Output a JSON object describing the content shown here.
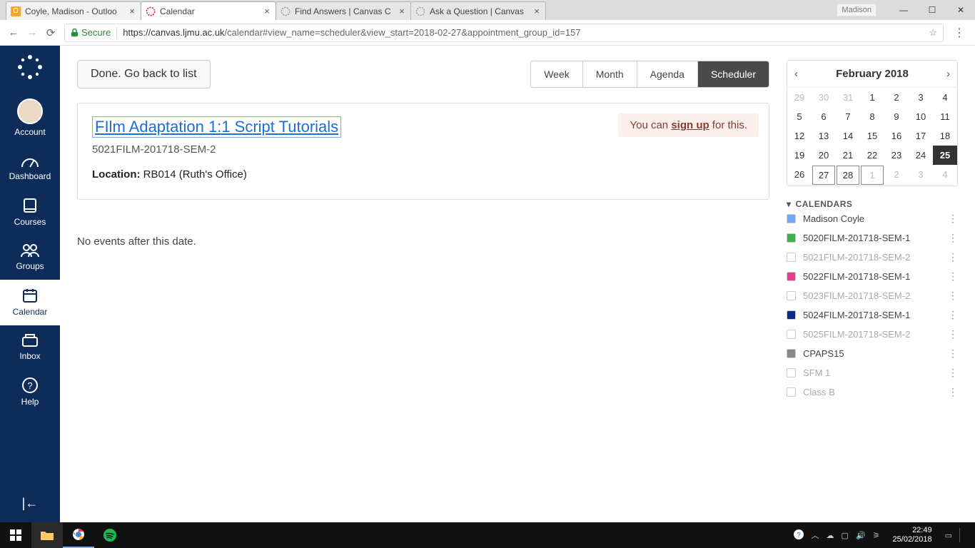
{
  "browser": {
    "tabs": [
      {
        "title": "Coyle, Madison - Outloo"
      },
      {
        "title": "Calendar"
      },
      {
        "title": "Find Answers | Canvas C"
      },
      {
        "title": "Ask a Question | Canvas"
      }
    ],
    "user_label": "Madison",
    "secure_label": "Secure",
    "url_host": "https://canvas.ljmu.ac.uk",
    "url_path": "/calendar#view_name=scheduler&view_start=2018-02-27&appointment_group_id=157"
  },
  "sidebar": {
    "items": [
      {
        "label": "Account"
      },
      {
        "label": "Dashboard"
      },
      {
        "label": "Courses"
      },
      {
        "label": "Groups"
      },
      {
        "label": "Calendar"
      },
      {
        "label": "Inbox"
      },
      {
        "label": "Help"
      }
    ]
  },
  "scheduler": {
    "done_label": "Done. Go back to list",
    "view_tabs": {
      "week": "Week",
      "month": "Month",
      "agenda": "Agenda",
      "scheduler": "Scheduler"
    },
    "event": {
      "title": "FIlm Adaptation 1:1 Script Tutorials",
      "subtitle": "5021FILM-201718-SEM-2",
      "location_label": "Location:",
      "location_value": "RB014 (Ruth's Office)",
      "signup_prefix": "You can ",
      "signup_link": "sign up",
      "signup_suffix": " for this."
    },
    "no_events": "No events after this date."
  },
  "minical": {
    "title": "February 2018",
    "cells": [
      {
        "d": "29",
        "muted": true
      },
      {
        "d": "30",
        "muted": true
      },
      {
        "d": "31",
        "muted": true
      },
      {
        "d": "1"
      },
      {
        "d": "2"
      },
      {
        "d": "3"
      },
      {
        "d": "4"
      },
      {
        "d": "5"
      },
      {
        "d": "6"
      },
      {
        "d": "7"
      },
      {
        "d": "8"
      },
      {
        "d": "9"
      },
      {
        "d": "10"
      },
      {
        "d": "11"
      },
      {
        "d": "12"
      },
      {
        "d": "13"
      },
      {
        "d": "14"
      },
      {
        "d": "15"
      },
      {
        "d": "16"
      },
      {
        "d": "17"
      },
      {
        "d": "18"
      },
      {
        "d": "19"
      },
      {
        "d": "20"
      },
      {
        "d": "21"
      },
      {
        "d": "22"
      },
      {
        "d": "23"
      },
      {
        "d": "24"
      },
      {
        "d": "25",
        "today": true
      },
      {
        "d": "26"
      },
      {
        "d": "27",
        "boxed": true
      },
      {
        "d": "28",
        "boxed": true
      },
      {
        "d": "1",
        "boxed": true,
        "muted": true
      },
      {
        "d": "2",
        "muted": true
      },
      {
        "d": "3",
        "muted": true
      },
      {
        "d": "4",
        "muted": true
      }
    ]
  },
  "calendars": {
    "heading": "CALENDARS",
    "items": [
      {
        "name": "Madison Coyle",
        "color": "#6fa8ff",
        "dim": false
      },
      {
        "name": "5020FILM-201718-SEM-1",
        "color": "#3fae4e",
        "dim": false
      },
      {
        "name": "5021FILM-201718-SEM-2",
        "color": "#ffffff",
        "dim": true
      },
      {
        "name": "5022FILM-201718-SEM-1",
        "color": "#e83e8c",
        "dim": false
      },
      {
        "name": "5023FILM-201718-SEM-2",
        "color": "#ffffff",
        "dim": true
      },
      {
        "name": "5024FILM-201718-SEM-1",
        "color": "#0d2c8a",
        "dim": false
      },
      {
        "name": "5025FILM-201718-SEM-2",
        "color": "#ffffff",
        "dim": true
      },
      {
        "name": "CPAPS15",
        "color": "#888888",
        "dim": false
      },
      {
        "name": "SFM 1",
        "color": "#ffffff",
        "dim": true
      },
      {
        "name": "Class B",
        "color": "#ffffff",
        "dim": true
      }
    ]
  },
  "taskbar": {
    "time": "22:49",
    "date": "25/02/2018"
  }
}
